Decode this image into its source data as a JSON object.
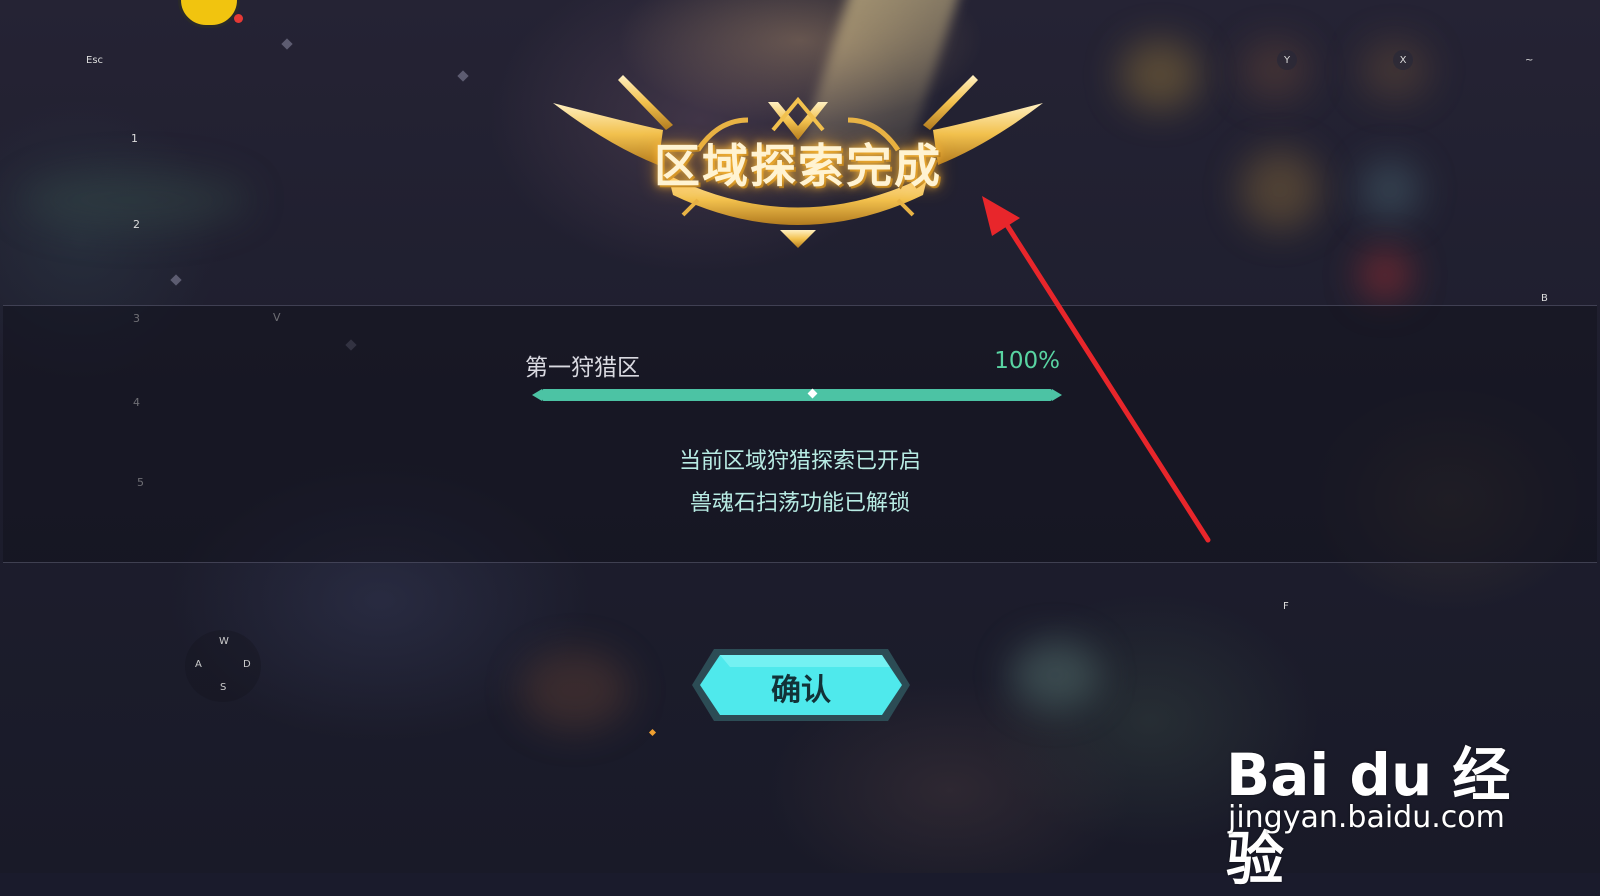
{
  "hud": {
    "esc_key": "Esc",
    "skill_keys": [
      "1",
      "2",
      "3",
      "4",
      "5"
    ],
    "v_key": "V",
    "y_key": "Y",
    "x_key": "X",
    "tilde_key": "~",
    "b_key": "B",
    "f_key": "F",
    "move_keys": {
      "up": "W",
      "left": "A",
      "right": "D",
      "down": "S"
    }
  },
  "banner": {
    "title": "区域探索完成"
  },
  "area": {
    "name": "第一狩猎区",
    "percent_label": "100%",
    "progress": 1.0
  },
  "messages": [
    "当前区域狩猎探索已开启",
    "兽魂石扫荡功能已解锁"
  ],
  "confirm_button": {
    "label": "确认"
  },
  "watermark": {
    "brand": "Bai du 经验",
    "url": "jingyan.baidu.com"
  },
  "colors": {
    "accent_green": "#59d4a2",
    "button_cyan": "#4fe9ec",
    "banner_gold": "#f2c14e",
    "arrow_red": "#e8262b"
  }
}
